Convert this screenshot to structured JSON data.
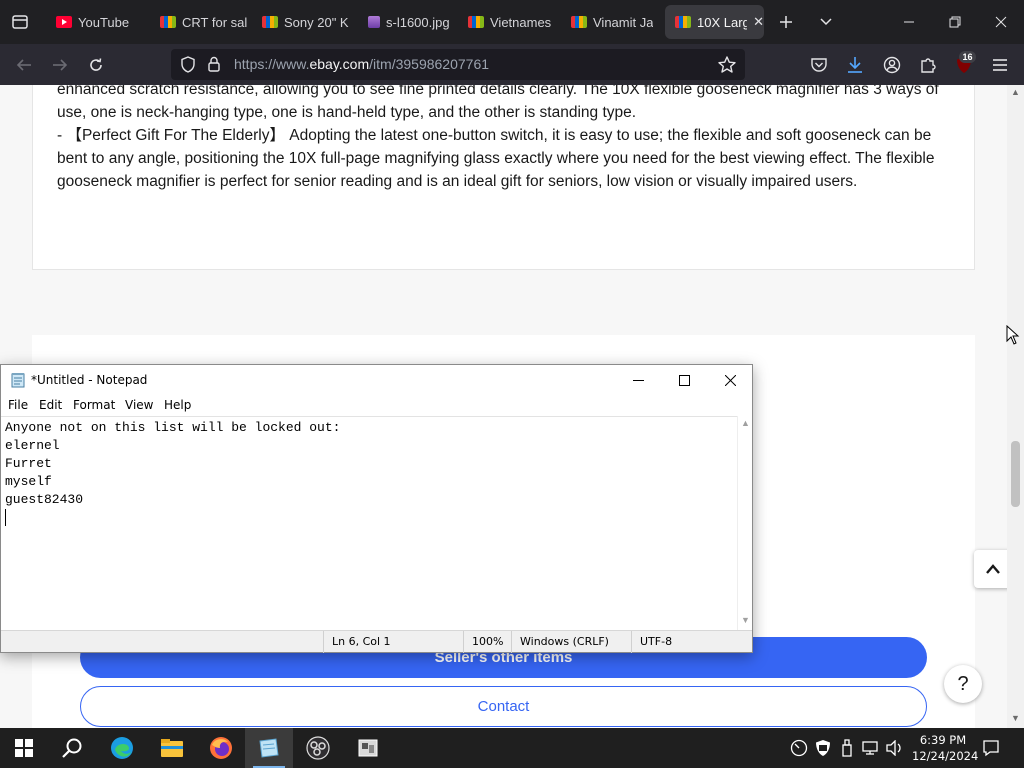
{
  "browser": {
    "tabs": [
      {
        "label": "YouTube",
        "favicon_color": "#ff0033"
      },
      {
        "label": "CRT for sal",
        "favicon_color": "#e53238"
      },
      {
        "label": "Sony 20\" K",
        "favicon_color": "#e53238"
      },
      {
        "label": "s-l1600.jpg",
        "favicon_color": "#9b59b6"
      },
      {
        "label": "Vietnames",
        "favicon_color": "#e53238"
      },
      {
        "label": "Vinamit Ja",
        "favicon_color": "#e53238"
      },
      {
        "label": "10X Larg",
        "favicon_color": "#e53238",
        "active": true
      }
    ],
    "url": {
      "scheme": "https://www.",
      "host": "ebay.com",
      "path": "/itm/395986207761"
    },
    "extensions_badge": "16",
    "accent_color": "#2b2a33"
  },
  "page": {
    "description": {
      "line1": "enhanced scratch resistance, allowing you to see fine printed details clearly. The 10X flexible gooseneck magnifier has 3 ways of use, one is neck-hanging type, one is hand-held type, and the other is standing type.",
      "line2": "- 【Perfect Gift For The Elderly】 Adopting the latest one-button switch, it is easy to use; the flexible and soft gooseneck can be bent to any angle, positioning the 10X full-page magnifying glass exactly where you need for the best viewing effect. The flexible gooseneck magnifier is perfect for senior reading and is an ideal gift for seniors, low vision or visually impaired users."
    },
    "seller_items_button": "Seller's other items",
    "contact_button": "Contact",
    "help_button": "?",
    "brand_blue": "#3665f3"
  },
  "notepad": {
    "title": "*Untitled - Notepad",
    "menu": [
      "File",
      "Edit",
      "Format",
      "View",
      "Help"
    ],
    "lines": [
      "Anyone not on this list will be locked out:",
      "elernel",
      "Furret",
      "myself",
      "guest82430",
      ""
    ],
    "status": {
      "position": "Ln 6, Col 1",
      "zoom": "100%",
      "line_endings": "Windows (CRLF)",
      "encoding": "UTF-8"
    }
  },
  "taskbar": {
    "apps": [
      "start-icon",
      "search-icon",
      "edge-icon",
      "file-explorer-icon",
      "firefox-icon",
      "notepad-icon",
      "obs-icon",
      "app-icon"
    ],
    "time": "6:39 PM",
    "date": "12/24/2024"
  }
}
